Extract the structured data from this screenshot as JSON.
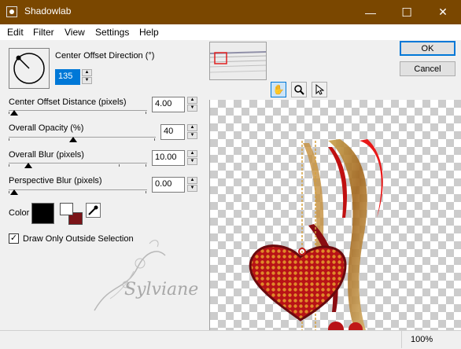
{
  "window": {
    "title": "Shadowlab",
    "minimize_glyph": "—",
    "maximize_glyph": "☐",
    "close_glyph": "✕",
    "titlebar_color": "#7a4700"
  },
  "menu": [
    "Edit",
    "Filter",
    "View",
    "Settings",
    "Help"
  ],
  "controls": {
    "direction": {
      "label": "Center Offset Direction (°)",
      "value": "135",
      "angle_degrees": 135
    },
    "distance": {
      "label": "Center Offset Distance (pixels)",
      "value": "4.00",
      "slider_fraction": 0.0
    },
    "opacity": {
      "label": "Overall Opacity (%)",
      "value": "40",
      "slider_fraction": 0.4
    },
    "blur": {
      "label": "Overall Blur (pixels)",
      "value": "10.00",
      "slider_fraction": 0.1
    },
    "perspective_blur": {
      "label": "Perspective Blur (pixels)",
      "value": "0.00",
      "slider_fraction": 0.0
    },
    "color": {
      "label": "Color",
      "shadow_color": "#000000",
      "fg_color": "#ffffff",
      "bg_color": "#7b1418"
    },
    "outside_only": {
      "label": "Draw Only Outside Selection",
      "checked": true
    }
  },
  "buttons": {
    "ok": "OK",
    "cancel": "Cancel"
  },
  "tools": {
    "pan": "pan-hand-icon",
    "zoom": "zoom-icon",
    "pointer": "arrow-pointer-icon"
  },
  "watermark": {
    "text": "Sylviane"
  },
  "status": {
    "zoom": "100%"
  }
}
